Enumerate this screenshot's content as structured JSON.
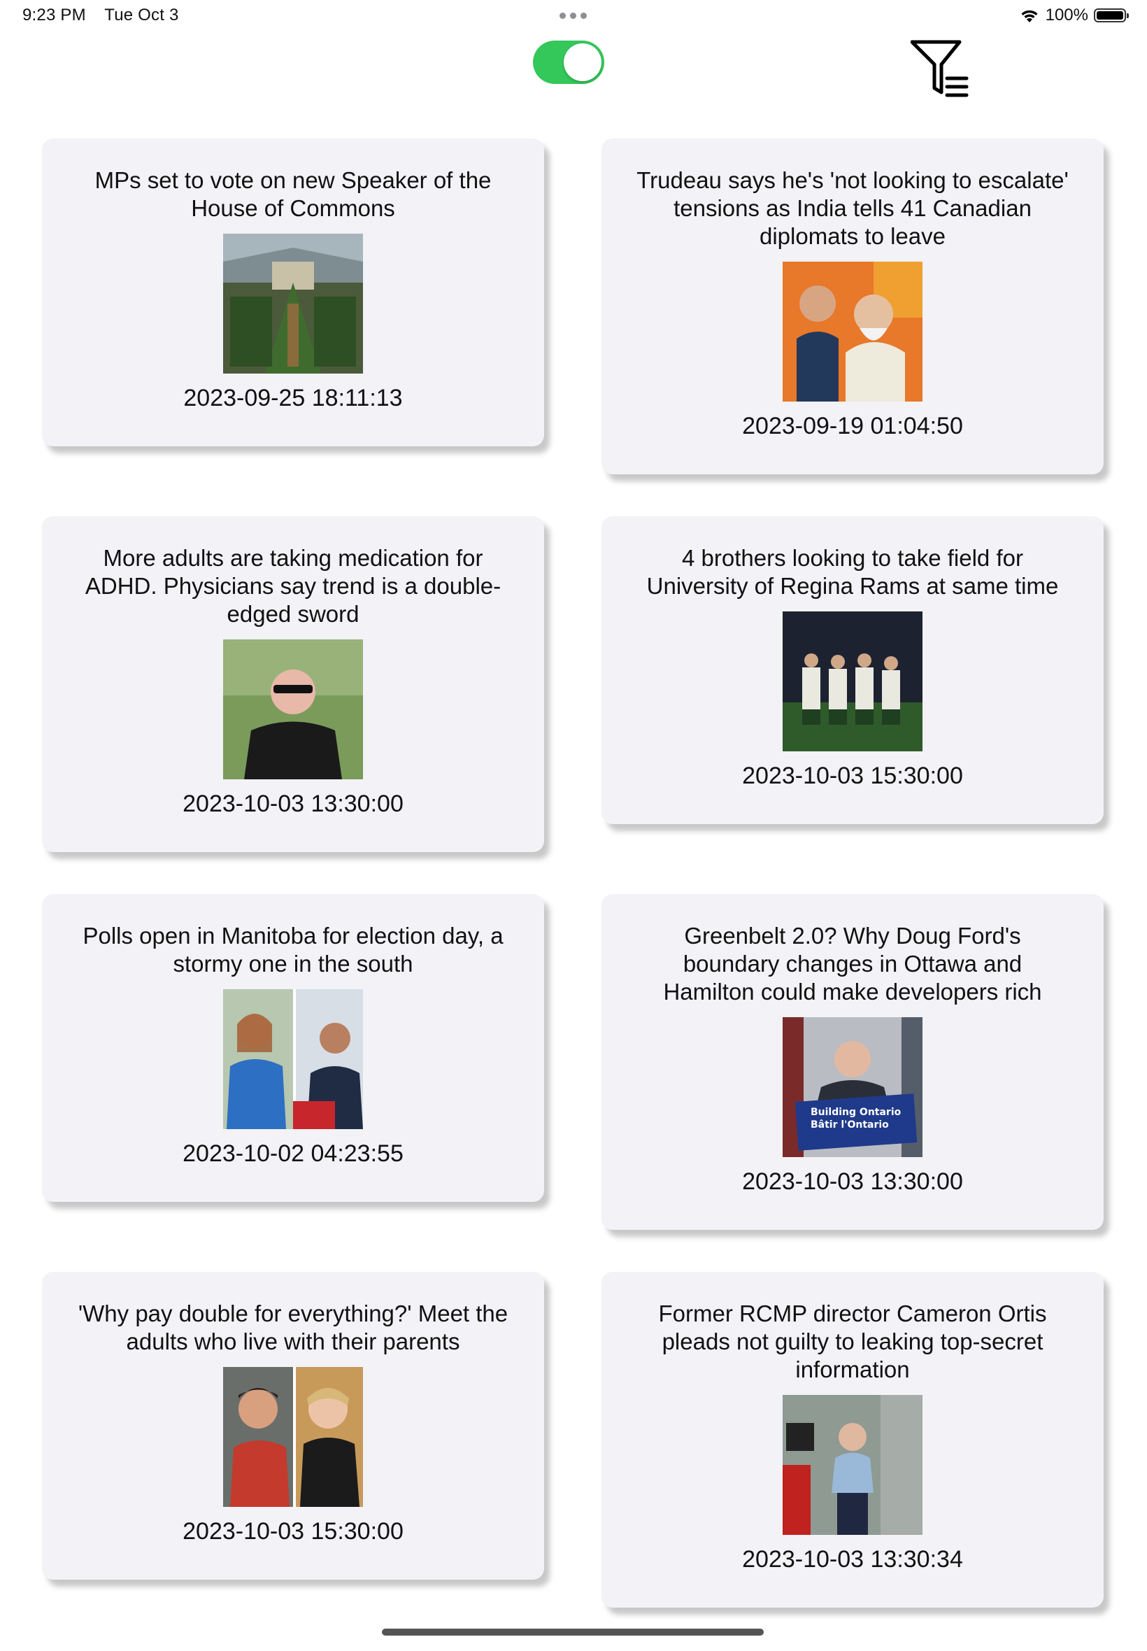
{
  "status_bar": {
    "time": "9:23 PM",
    "date": "Tue Oct 3",
    "battery": "100%"
  },
  "toolbar": {
    "toggle_on": true,
    "accent_color": "#34c759",
    "filter_icon": "filter-list-icon"
  },
  "articles": [
    {
      "title": "MPs set to vote on new Speaker of the House of Commons",
      "date": "2023-09-25 18:11:13",
      "image": "house-of-commons-chamber-photo"
    },
    {
      "title": "Trudeau says he's 'not looking to escalate' tensions as India tells 41 Canadian diplomats to leave",
      "date": "2023-09-19 01:04:50",
      "image": "trudeau-modi-photo"
    },
    {
      "title": "More adults are taking medication for ADHD. Physicians say trend is a double-edged sword",
      "date": "2023-10-03 13:30:00",
      "image": "man-portrait-photo"
    },
    {
      "title": "4 brothers looking to take field for University of Regina Rams at same time",
      "date": "2023-10-03 15:30:00",
      "image": "football-brothers-photo"
    },
    {
      "title": "Polls open in Manitoba for election day, a stormy one in the south",
      "date": "2023-10-02 04:23:55",
      "image": "manitoba-candidates-photo"
    },
    {
      "title": "Greenbelt 2.0? Why Doug Ford's boundary changes in Ottawa and Hamilton could make developers rich",
      "date": "2023-10-03 13:30:00",
      "image": "doug-ford-podium-photo"
    },
    {
      "title": "'Why pay double for everything?' Meet the adults who live with their parents",
      "date": "2023-10-03 15:30:00",
      "image": "adults-with-parents-photo"
    },
    {
      "title": "Former RCMP director Cameron Ortis pleads not guilty to leaking top-secret information",
      "date": "2023-10-03 13:30:34",
      "image": "cameron-ortis-photo"
    }
  ],
  "podium_sign": {
    "line1": "Building Ontario",
    "line2": "Bâtir l'Ontario"
  }
}
